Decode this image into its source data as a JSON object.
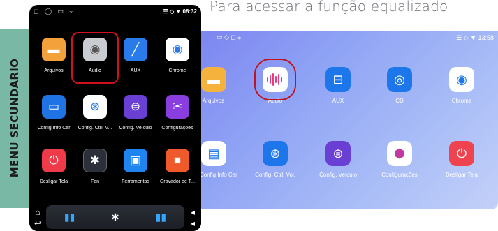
{
  "caption": "Para acessar a função equalizado",
  "sidebar_label": "MENU SECUNDARIO",
  "phone": {
    "status_left": "◻ ◯ ▭  ⁎",
    "status_right": "☰ ◇ ▼ 08:32",
    "apps": [
      {
        "label": "Arquivos",
        "icon": "folder-icon",
        "color": "#f3a23b"
      },
      {
        "label": "Áudio",
        "icon": "audio-knob-icon",
        "color": "#c9ccd1",
        "selected": true
      },
      {
        "label": "AUX",
        "icon": "aux-cable-icon",
        "color": "#2a7bea"
      },
      {
        "label": "Chrome",
        "icon": "chrome-icon",
        "color": "#ffffff"
      },
      {
        "label": "Config Info Car",
        "icon": "car-info-icon",
        "color": "#1f73e5"
      },
      {
        "label": "Config. Ctrl. V...",
        "icon": "steering-wheel-icon",
        "color": "#ffffff"
      },
      {
        "label": "Config. Veículo",
        "icon": "car-settings-icon",
        "color": "#6a3fd4"
      },
      {
        "label": "Configurações",
        "icon": "tools-icon",
        "color": "#8b3ee0"
      },
      {
        "label": "Desligar Tela",
        "icon": "power-icon",
        "color": "#ef3a4a"
      },
      {
        "label": "Fan",
        "icon": "fan-icon",
        "color": "#2b2f3a"
      },
      {
        "label": "Ferramentas",
        "icon": "toolbox-icon",
        "color": "#1d84f0"
      },
      {
        "label": "Gravador de T...",
        "icon": "recorder-icon",
        "color": "#f05a2a"
      }
    ],
    "dock": {
      "left_icon": "bars-left-icon",
      "center_icon": "bluetooth-icon",
      "right_icon": "bars-right-icon"
    }
  },
  "tablet": {
    "status_left": "▭ ◇ ◻  ⁎",
    "status_right": "☰ ◇ ▼ 13:58",
    "apps_row1": [
      {
        "label": "Arquivos",
        "icon": "folder-icon",
        "color": "#f5b23d"
      },
      {
        "label": "Áudio",
        "icon": "audio-wave-icon",
        "color": "#ffffff",
        "selected": true
      },
      {
        "label": "AUX",
        "icon": "aux-cable-icon",
        "color": "#1d76ea"
      },
      {
        "label": "CD",
        "icon": "disc-icon",
        "color": "#1d76ea"
      },
      {
        "label": "Chrome",
        "icon": "chrome-blue-icon",
        "color": "#ffffff"
      }
    ],
    "apps_row2": [
      {
        "label": "Config Info Car",
        "icon": "car-info-icon",
        "color": "#ffffff"
      },
      {
        "label": "Config. Ctrl. Vol.",
        "icon": "steering-wheel-icon",
        "color": "#1d76ea"
      },
      {
        "label": "Config. Veículo",
        "icon": "car-settings-icon",
        "color": "#6a3fd4"
      },
      {
        "label": "Configurações",
        "icon": "settings-shape-icon",
        "color": "#ffffff"
      },
      {
        "label": "Desligar Tela",
        "icon": "power-icon",
        "color": "#ef4350"
      }
    ]
  }
}
